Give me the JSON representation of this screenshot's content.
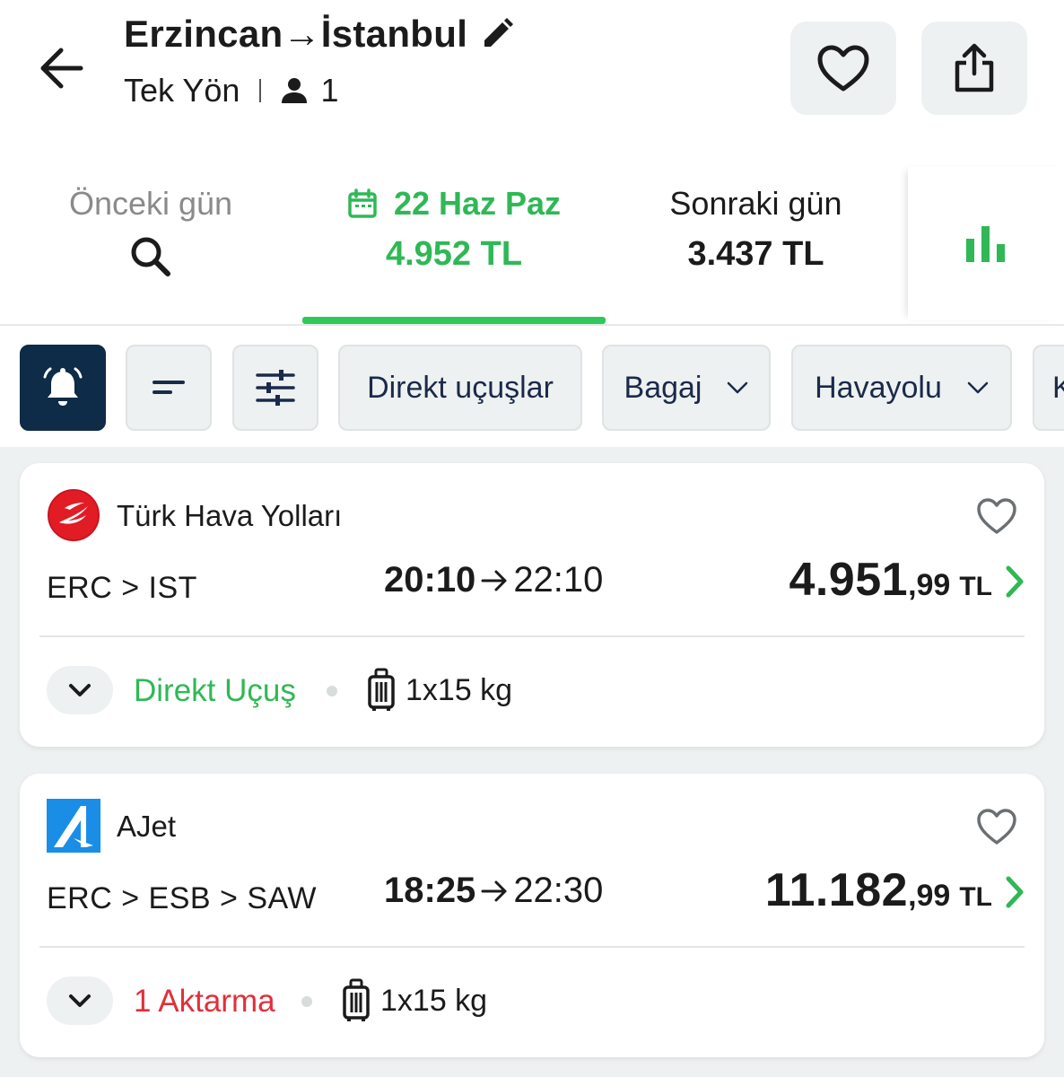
{
  "header": {
    "route_title": "Erzincan→İstanbul",
    "trip_type": "Tek Yön",
    "passengers": "1"
  },
  "date_tabs": {
    "previous": {
      "label": "Önceki gün"
    },
    "current": {
      "label": "22 Haz Paz",
      "price": "4.952 TL"
    },
    "next": {
      "label": "Sonraki gün",
      "price": "3.437 TL"
    }
  },
  "filters": {
    "direct": "Direkt uçuşlar",
    "baggage": "Bagaj",
    "airline": "Havayolu",
    "more": "K"
  },
  "flights": [
    {
      "airline": "Türk Hava Yolları",
      "route": "ERC > IST",
      "departure": "20:10",
      "arrival": "22:10",
      "price_main": "4.951",
      "price_decimal": ",99",
      "currency": "TL",
      "stops": "Direkt Uçuş",
      "baggage": "1x15 kg"
    },
    {
      "airline": "AJet",
      "route": "ERC > ESB > SAW",
      "departure": "18:25",
      "arrival": "22:30",
      "price_main": "11.182",
      "price_decimal": ",99",
      "currency": "TL",
      "stops": "1 Aktarma",
      "baggage": "1x15 kg"
    }
  ],
  "colors": {
    "accent_green": "#2fb855",
    "alert_red": "#e0303a",
    "navy": "#0e2b47",
    "chip_bg": "#eef1f1"
  },
  "icons": [
    "back-arrow-icon",
    "pencil-icon",
    "person-icon",
    "heart-icon",
    "share-icon",
    "search-icon",
    "calendar-icon",
    "bar-chart-icon",
    "bell-icon",
    "sort-icon",
    "sliders-icon",
    "chevron-down-icon",
    "chevron-right-icon",
    "luggage-icon"
  ]
}
